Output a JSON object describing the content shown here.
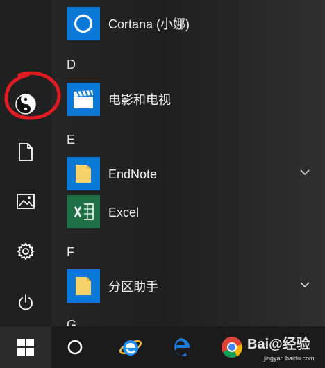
{
  "start_menu": {
    "side_rail": [
      {
        "icon": "yin-yang-icon",
        "annotated": true,
        "annotation_color": "#e11b22"
      },
      {
        "icon": "document-icon"
      },
      {
        "icon": "pictures-icon"
      },
      {
        "icon": "gear-icon"
      },
      {
        "icon": "power-icon"
      }
    ],
    "app_list": [
      {
        "name": "Cortana (小娜)",
        "icon": "cortana-icon",
        "tile_color": "#0a78d7"
      },
      {
        "section": "D"
      },
      {
        "name": "电影和电视",
        "icon": "clapperboard-icon",
        "tile_color": "#0a78d7"
      },
      {
        "section": "E"
      },
      {
        "name": "EndNote",
        "icon": "folder-icon",
        "tile_color": "#0a78d7",
        "expandable": true
      },
      {
        "name": "Excel",
        "icon": "excel-icon",
        "tile_color": "#1f7145"
      },
      {
        "section": "F"
      },
      {
        "name": "分区助手",
        "icon": "folder-icon",
        "tile_color": "#0a78d7",
        "expandable": true
      },
      {
        "section": "G"
      }
    ]
  },
  "taskbar": {
    "items": [
      {
        "icon": "windows-logo-icon"
      },
      {
        "icon": "cortana-circle-icon"
      },
      {
        "icon": "internet-explorer-icon"
      },
      {
        "icon": "edge-icon"
      },
      {
        "icon": "chrome-icon"
      }
    ]
  },
  "watermark": {
    "logo": "Bai@经验",
    "url": "jingyan.baidu.com"
  },
  "colors": {
    "accent": "#0a78d7",
    "excel": "#1f7145",
    "annotation": "#e11b22"
  }
}
